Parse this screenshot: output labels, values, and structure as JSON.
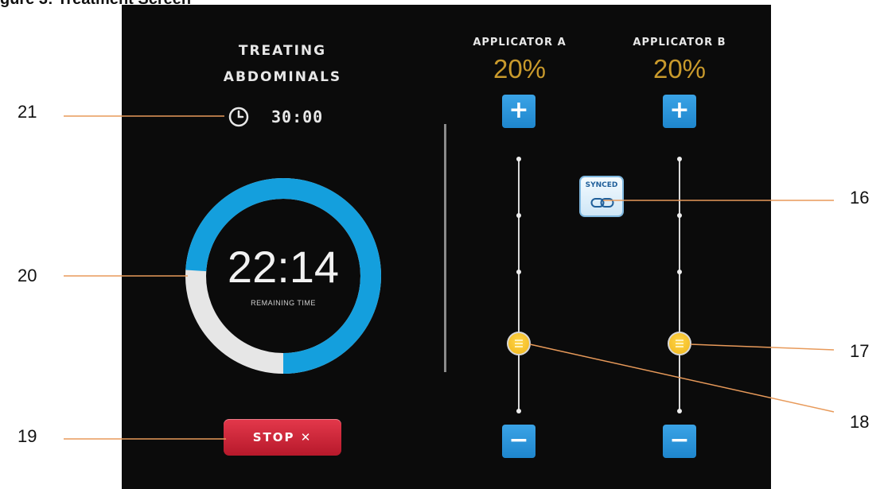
{
  "caption": "gure 3: Treatment Screen",
  "treatment": {
    "label_line1": "TREATING",
    "label_line2": "ABDOMINALS",
    "total_time": "30:00",
    "remaining_time": "22:14",
    "remaining_label": "REMAINING TIME",
    "progress_fraction_remaining": 0.74
  },
  "stop_button": {
    "label": "STOP ✕"
  },
  "applicator_a": {
    "title": "APPLICATOR A",
    "percent": "20%",
    "plus": "+",
    "minus": "−"
  },
  "applicator_b": {
    "title": "APPLICATOR B",
    "percent": "20%",
    "plus": "+",
    "minus": "−"
  },
  "sync": {
    "label": "SYNCED"
  },
  "callouts": {
    "c21": "21",
    "c20": "20",
    "c19": "19",
    "c16": "16",
    "c17": "17",
    "c18": "18"
  },
  "colors": {
    "screen_bg": "#0b0b0b",
    "ring_active": "#149fdd",
    "ring_inactive": "#e6e6e6",
    "accent_blue": "#2a94d9",
    "percent_gold": "#c99a2c",
    "stop_red": "#d22a3c",
    "knob_yellow": "#f6c12b",
    "callout_line": "#e89a5a"
  },
  "icons": [
    "clock-icon",
    "link-icon",
    "close-icon",
    "plus-icon",
    "minus-icon",
    "slider-knob-icon"
  ]
}
